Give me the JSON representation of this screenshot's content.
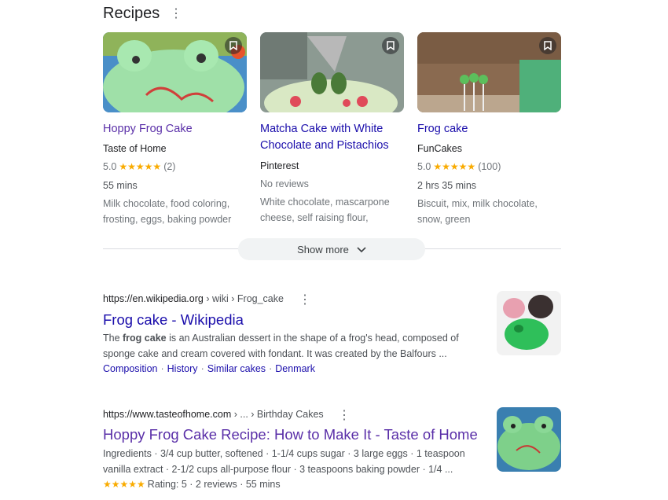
{
  "recipes": {
    "title": "Recipes",
    "cards": [
      {
        "title": "Hoppy Frog Cake",
        "source": "Taste of Home",
        "rating": "5.0",
        "reviews": "(2)",
        "time": "55 mins",
        "ingredients_1": "Milk chocolate, food coloring,",
        "ingredients_2": "frosting, eggs, baking powder"
      },
      {
        "title_1": "Matcha Cake with White",
        "title_2": "Chocolate and Pistachios",
        "source": "Pinterest",
        "no_reviews": "No reviews",
        "ingredients_1": "White chocolate, mascarpone",
        "ingredients_2": "cheese, self raising flour,"
      },
      {
        "title": "Frog cake",
        "source": "FunCakes",
        "rating": "5.0",
        "reviews": "(100)",
        "time": "2 hrs 35 mins",
        "ingredients_1": "Biscuit, mix, milk chocolate,",
        "ingredients_2": "snow, green"
      }
    ],
    "show_more": "Show more"
  },
  "results": [
    {
      "url_base": "https://en.wikipedia.org",
      "url_path": " › wiki › Frog_cake",
      "title": "Frog cake - Wikipedia",
      "snippet_pre": "The ",
      "snippet_bold": "frog cake",
      "snippet_post": " is an Australian dessert in the shape of a frog's head, composed of",
      "snippet_2": "sponge cake and cream covered with fondant. It was created by the Balfours ...",
      "sitelinks": [
        "Composition",
        "History",
        "Similar cakes",
        "Denmark"
      ]
    },
    {
      "url_base": "https://www.tasteofhome.com",
      "url_path": " › ... › Birthday Cakes",
      "title": "Hoppy Frog Cake Recipe: How to Make It - Taste of Home",
      "snippet_1": "Ingredients · 3/4 cup butter, softened · 1-1/4 cups sugar · 3 large eggs · 1 teaspoon",
      "snippet_2": "vanilla extract · 2-1/2 cups all-purpose flour · 3 teaspoons baking powder · 1/4 ...",
      "rating_text": "Rating: 5 · 2 reviews · 55 mins"
    }
  ],
  "colors": {
    "link": "#1a0dab",
    "visited": "#5a2fa8",
    "star": "#f9ab00"
  }
}
